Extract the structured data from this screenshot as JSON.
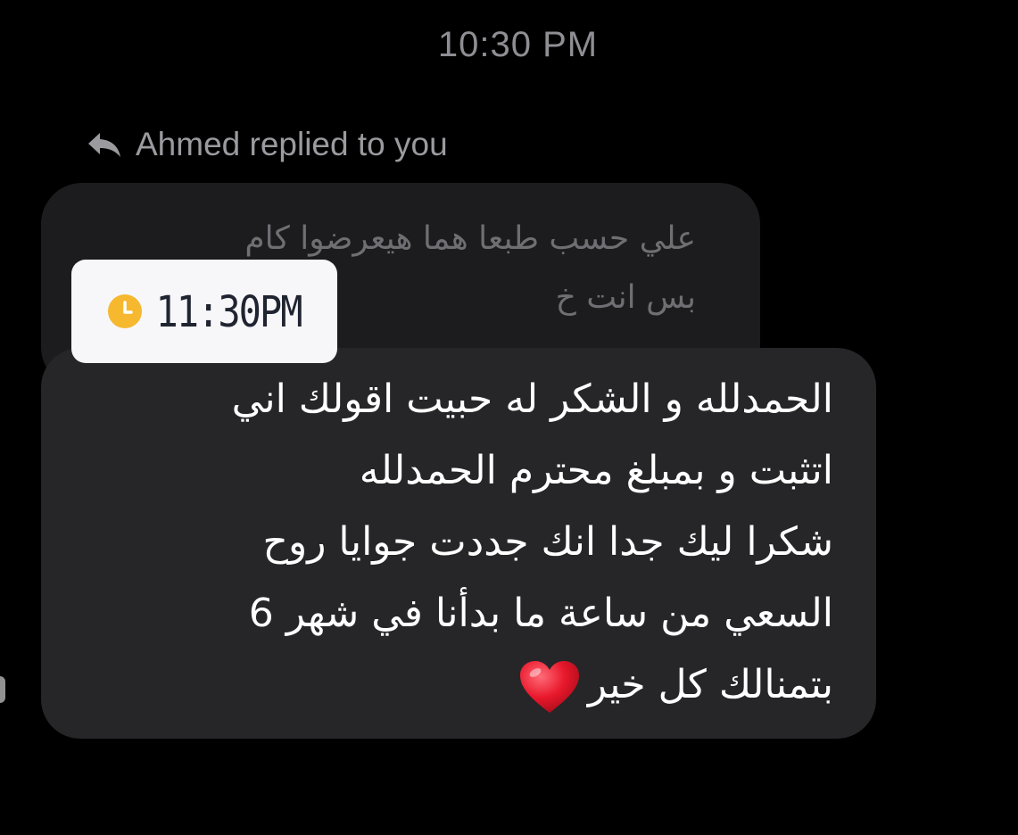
{
  "thread": {
    "timestamp": "10:30 PM",
    "reply_indicator": {
      "icon": "reply-arrow-icon",
      "text": "Ahmed replied to you"
    }
  },
  "quoted_message": {
    "lines": [
      "علي حسب طبعا هما هيعرضوا كام",
      "بس انت خ"
    ]
  },
  "time_sticker": {
    "icon": "clock-icon",
    "icon_color": "#F5B82E",
    "text": "11:30PM"
  },
  "reply_message": {
    "lines": [
      "الحمدلله و الشكر له حبيت اقولك اني",
      "اتثبت و بمبلغ محترم الحمدلله",
      "شكرا ليك جدا انك جددت جوايا روح",
      "السعي من ساعة ما بدأنا في شهر 6",
      "بتمنالك كل خير"
    ],
    "emoji": "heart-icon",
    "emoji_color": "#E8182B"
  },
  "colors": {
    "background": "#000000",
    "quoted_bubble": "#1C1C1E",
    "reply_bubble": "#262629",
    "muted_text": "#8E8E93"
  }
}
